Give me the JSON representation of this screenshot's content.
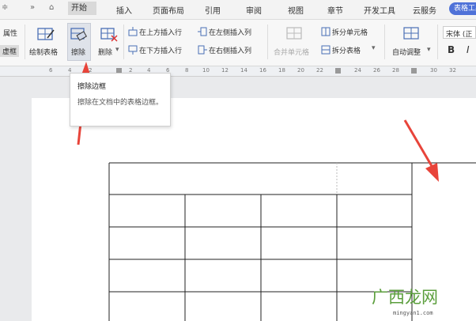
{
  "menu": {
    "items": [
      "开始",
      "插入",
      "页面布局",
      "引用",
      "审阅",
      "视图",
      "章节",
      "开发工具",
      "云服务"
    ],
    "active_tab": "表格工具",
    "left_symbols": [
      "≑",
      "»",
      "⌂"
    ]
  },
  "ribbon": {
    "properties": "属性",
    "frame": "虚框",
    "draw_table": "绘制表格",
    "eraser": "擦除",
    "delete": "删除",
    "insert_above": "在上方插入行",
    "insert_below": "在下方插入行",
    "insert_left": "在左侧插入列",
    "insert_right": "在右侧插入列",
    "merge_cells": "合并单元格",
    "split_cells": "拆分单元格",
    "split_table": "拆分表格",
    "autofit": "自动调整",
    "font": "宋体 (正",
    "bold": "B",
    "italic": "I"
  },
  "ruler": {
    "marks": [
      "6",
      "4",
      "2",
      "2",
      "4",
      "6",
      "8",
      "10",
      "12",
      "14",
      "16",
      "18",
      "20",
      "22",
      "24",
      "26",
      "28",
      "30",
      "32"
    ]
  },
  "tooltip": {
    "title": "擦除边框",
    "body": "擦除在文档中的表格边框。"
  },
  "watermark": {
    "text": "广西龙网",
    "url": "mingyan1.com"
  },
  "colors": {
    "accent": "#4f72d8",
    "arrow": "#e8443a",
    "watermark": "#5b9e3c"
  }
}
